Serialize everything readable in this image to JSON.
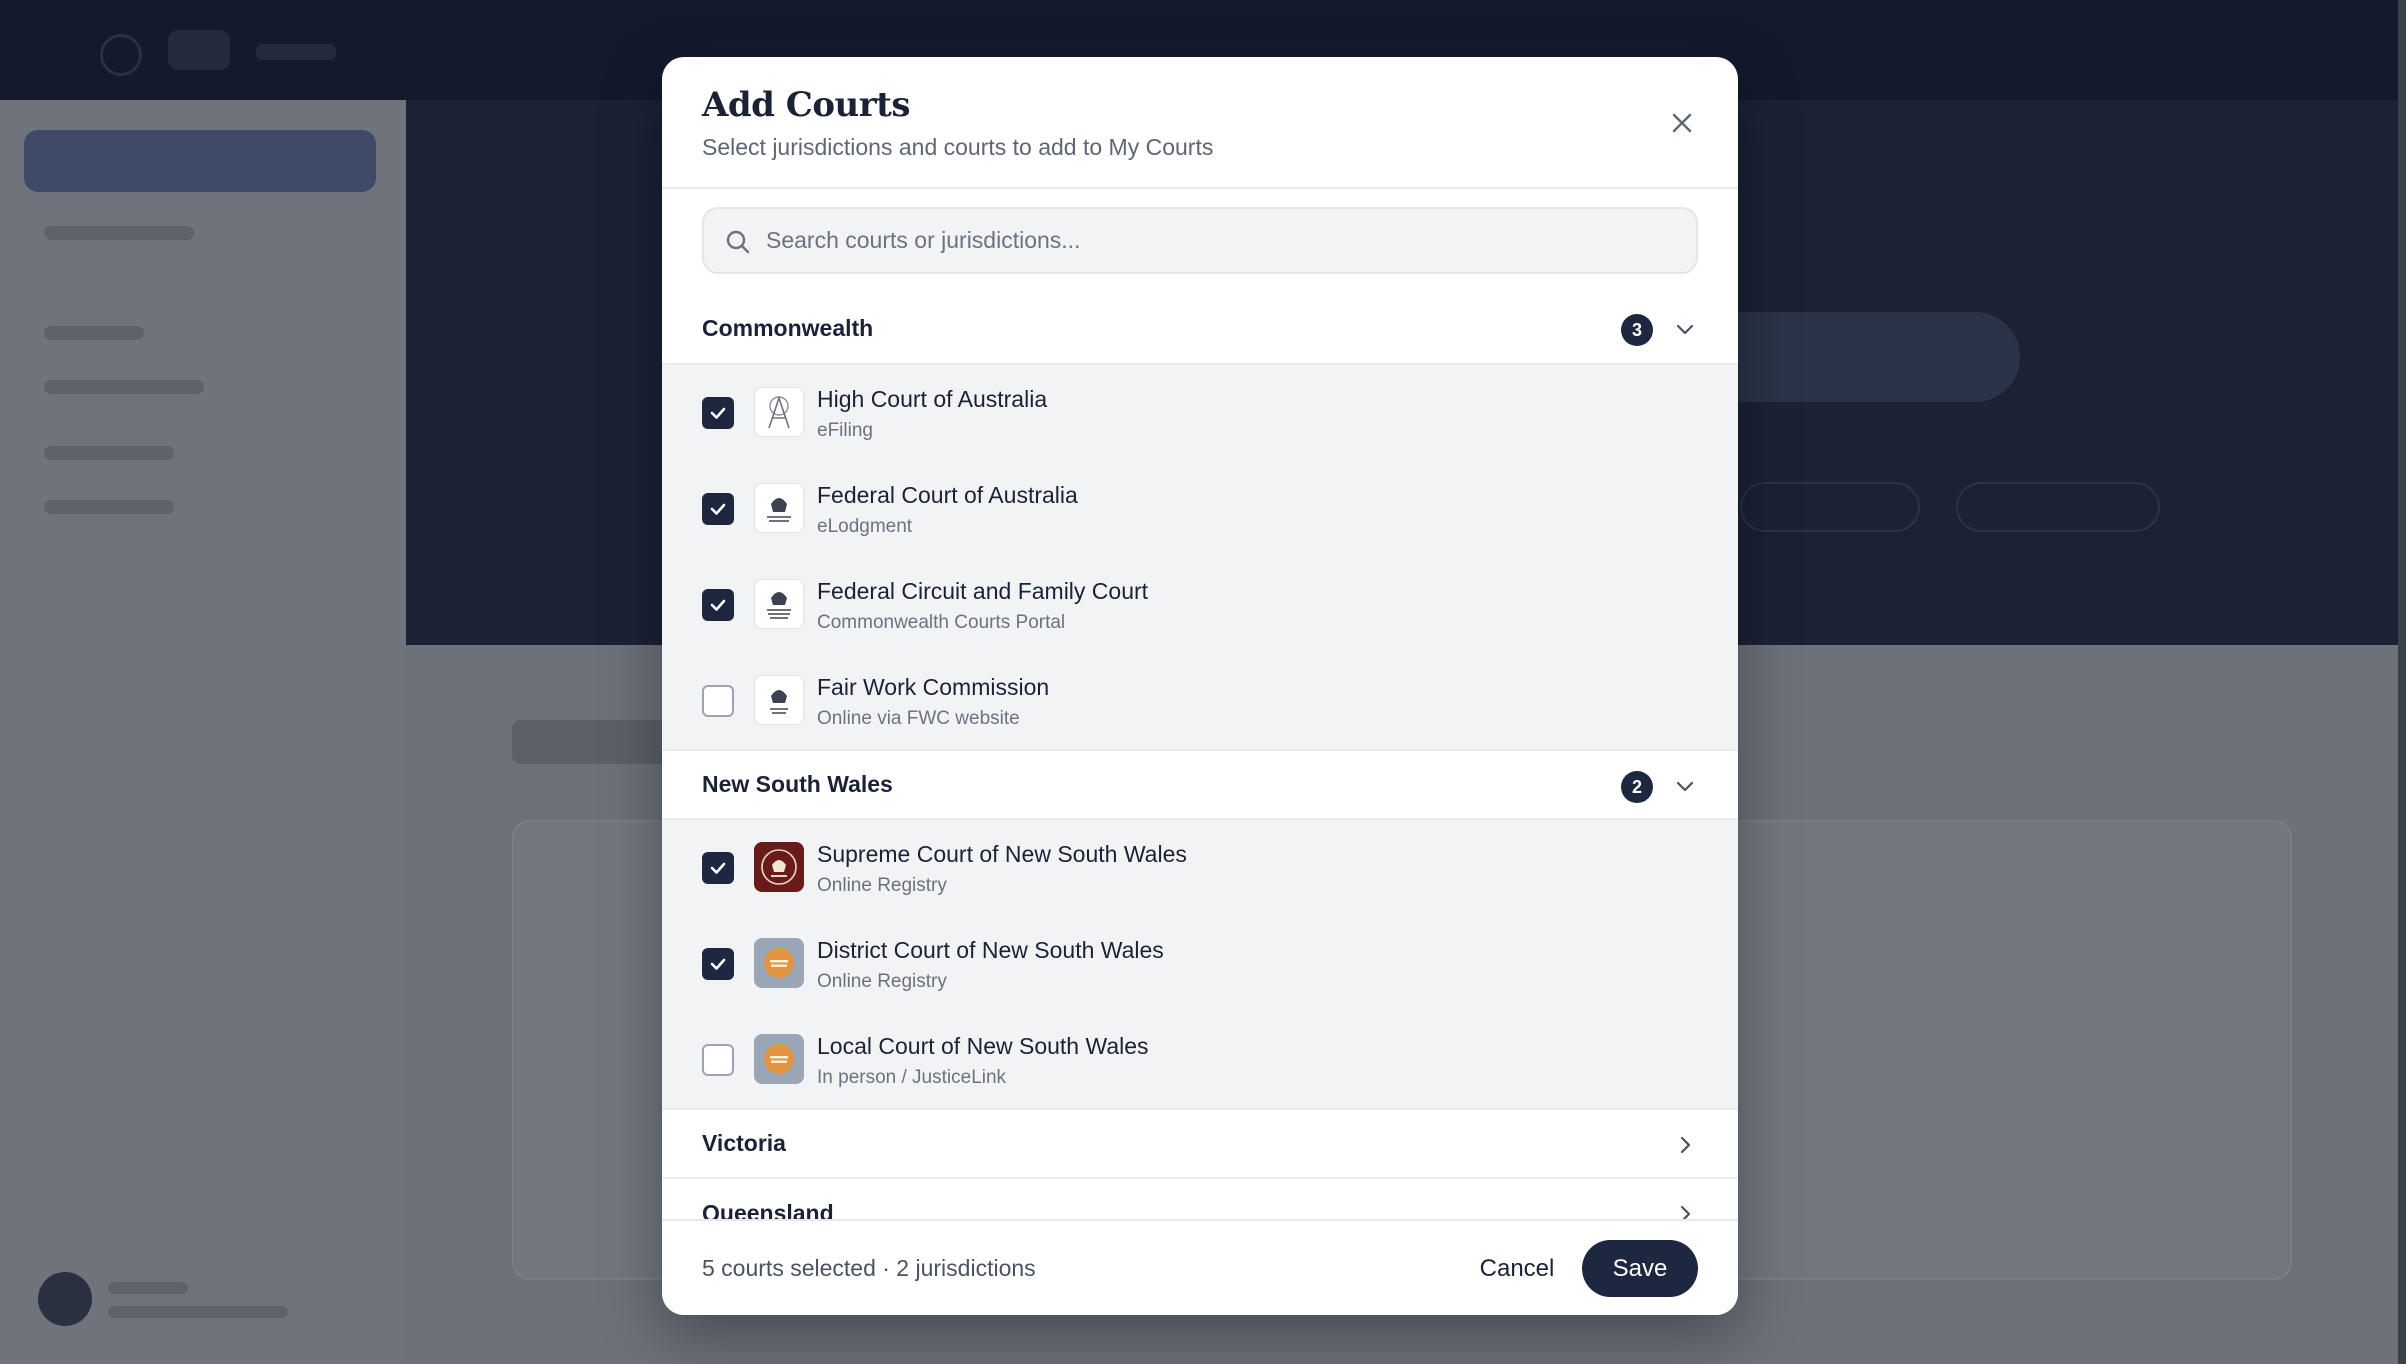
{
  "modal": {
    "title": "Add Courts",
    "subtitle": "Select jurisdictions and courts to add to My Courts",
    "close_icon": "close-icon"
  },
  "search": {
    "placeholder": "Search courts or jurisdictions...",
    "value": ""
  },
  "groups": [
    {
      "name": "Commonwealth",
      "count": "3",
      "expanded": true,
      "courts": [
        {
          "name": "High Court of Australia",
          "subtitle": "eFiling",
          "checked": true,
          "logo": "australian-crest-icon"
        },
        {
          "name": "Federal Court of Australia",
          "subtitle": "eLodgment",
          "checked": true,
          "logo": "federal-court-crest-icon"
        },
        {
          "name": "Federal Circuit and Family Court",
          "subtitle": "Commonwealth Courts Portal",
          "checked": true,
          "logo": "federal-circuit-crest-icon"
        },
        {
          "name": "Fair Work Commission",
          "subtitle": "Online via FWC website",
          "checked": false,
          "logo": "fair-work-crest-icon"
        }
      ]
    },
    {
      "name": "New South Wales",
      "count": "2",
      "expanded": true,
      "courts": [
        {
          "name": "Supreme Court of New South Wales",
          "subtitle": "Online Registry",
          "checked": true,
          "logo": "supreme-court-seal-icon"
        },
        {
          "name": "District Court of New South Wales",
          "subtitle": "Online Registry",
          "checked": true,
          "logo": "nsw-courts-icon"
        },
        {
          "name": "Local Court of New South Wales",
          "subtitle": "In person / JusticeLink",
          "checked": false,
          "logo": "nsw-courts-icon"
        }
      ]
    },
    {
      "name": "Victoria",
      "expanded": false
    },
    {
      "name": "Queensland",
      "expanded": false
    }
  ],
  "footer": {
    "summary": "5 courts selected · 2 jurisdictions",
    "cancel_label": "Cancel",
    "save_label": "Save"
  },
  "colors": {
    "primary": "#1e2740",
    "row_background": "#f2f3f5",
    "overlay": "#6c717a"
  }
}
